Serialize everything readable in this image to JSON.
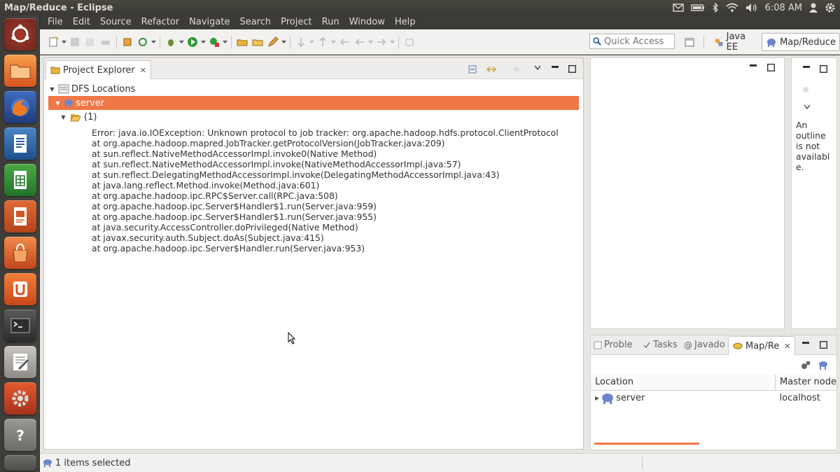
{
  "window": {
    "title": "Map/Reduce - Eclipse"
  },
  "panel_indicators": {
    "clock": "6:08 AM"
  },
  "menubar": [
    "File",
    "Edit",
    "Source",
    "Refactor",
    "Navigate",
    "Search",
    "Project",
    "Run",
    "Window",
    "Help"
  ],
  "quick_access": {
    "placeholder": "Quick Access"
  },
  "perspectives": [
    {
      "label": "Java EE",
      "icon": "java-ee-perspective-icon"
    },
    {
      "label": "Map/Reduce",
      "icon": "elephant-icon",
      "active": true
    }
  ],
  "project_explorer": {
    "tab_label": "Project Explorer",
    "root": "DFS Locations",
    "server": "server",
    "folder": "(1)",
    "error_lines": [
      "Error: java.io.IOException: Unknown protocol to job tracker: org.apache.hadoop.hdfs.protocol.ClientProtocol",
      "at org.apache.hadoop.mapred.JobTracker.getProtocolVersion(JobTracker.java:209)",
      "at sun.reflect.NativeMethodAccessorImpl.invoke0(Native Method)",
      "at sun.reflect.NativeMethodAccessorImpl.invoke(NativeMethodAccessorImpl.java:57)",
      "at sun.reflect.DelegatingMethodAccessorImpl.invoke(DelegatingMethodAccessorImpl.java:43)",
      "at java.lang.reflect.Method.invoke(Method.java:601)",
      "at org.apache.hadoop.ipc.RPC$Server.call(RPC.java:508)",
      "at org.apache.hadoop.ipc.Server$Handler$1.run(Server.java:959)",
      "at org.apache.hadoop.ipc.Server$Handler$1.run(Server.java:955)",
      "at java.security.AccessController.doPrivileged(Native Method)",
      "at javax.security.auth.Subject.doAs(Subject.java:415)",
      "at org.apache.hadoop.ipc.Server$Handler.run(Server.java:953)"
    ]
  },
  "outline": {
    "message_lines": [
      "An",
      "outline",
      "is not",
      "availabl",
      "e."
    ]
  },
  "bottom_panel": {
    "tabs": [
      {
        "label": "Proble"
      },
      {
        "label": "Tasks"
      },
      {
        "label": "Javado"
      },
      {
        "label": "Map/Re",
        "active": true
      }
    ],
    "columns": [
      "Location",
      "Master node"
    ],
    "rows": [
      {
        "location": "server",
        "master": "localhost"
      }
    ]
  },
  "status": {
    "text": "1 items selected"
  },
  "colors": {
    "selection": "#f07746",
    "ubuntu_panel": "#3c3b37",
    "progress": "#f07746"
  }
}
